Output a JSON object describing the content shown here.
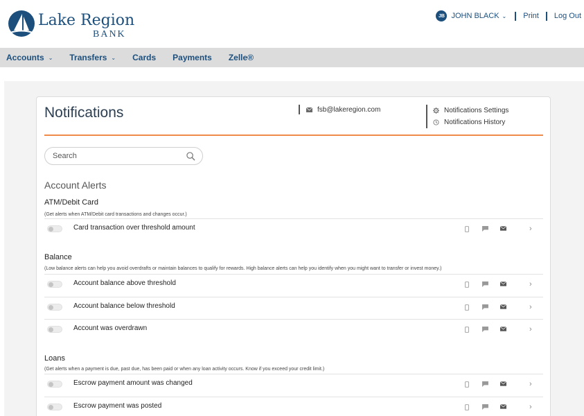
{
  "brand": {
    "name": "Lake Region",
    "sub": "BANK",
    "color": "#1d4f7c",
    "accent": "#f08a4b"
  },
  "user": {
    "initials": "JB",
    "name": "JOHN BLACK",
    "menu_icon": "chevron-down-icon"
  },
  "top_links": {
    "print": "Print",
    "logout": "Log Out"
  },
  "nav": {
    "accounts": "Accounts",
    "transfers": "Transfers",
    "cards": "Cards",
    "payments": "Payments",
    "zelle": "Zelle®"
  },
  "notifications": {
    "title": "Notifications",
    "email": "fsb@lakeregion.com",
    "settings_label": "Notifications Settings",
    "history_label": "Notifications History"
  },
  "search": {
    "placeholder": "Search"
  },
  "section": {
    "title": "Account Alerts"
  },
  "groups": [
    {
      "title": "ATM/Debit Card",
      "description": "(Get alerts when ATM/Debit card transactions and changes occur.)",
      "alerts": [
        "Card transaction over threshold amount"
      ]
    },
    {
      "title": "Balance",
      "description": "(Low balance alerts can help you avoid overdrafts or maintain balances to qualify for rewards. High balance alerts can help you identify when you might want to transfer or invest money.)",
      "alerts": [
        "Account balance above threshold",
        "Account balance below threshold",
        "Account was overdrawn"
      ]
    },
    {
      "title": "Loans",
      "description": "(Get alerts when a payment is due, past due, has been paid or when any loan activity occurs. Know if you exceed your credit limit.)",
      "alerts": [
        "Escrow payment amount was changed",
        "Escrow payment was posted"
      ]
    }
  ]
}
